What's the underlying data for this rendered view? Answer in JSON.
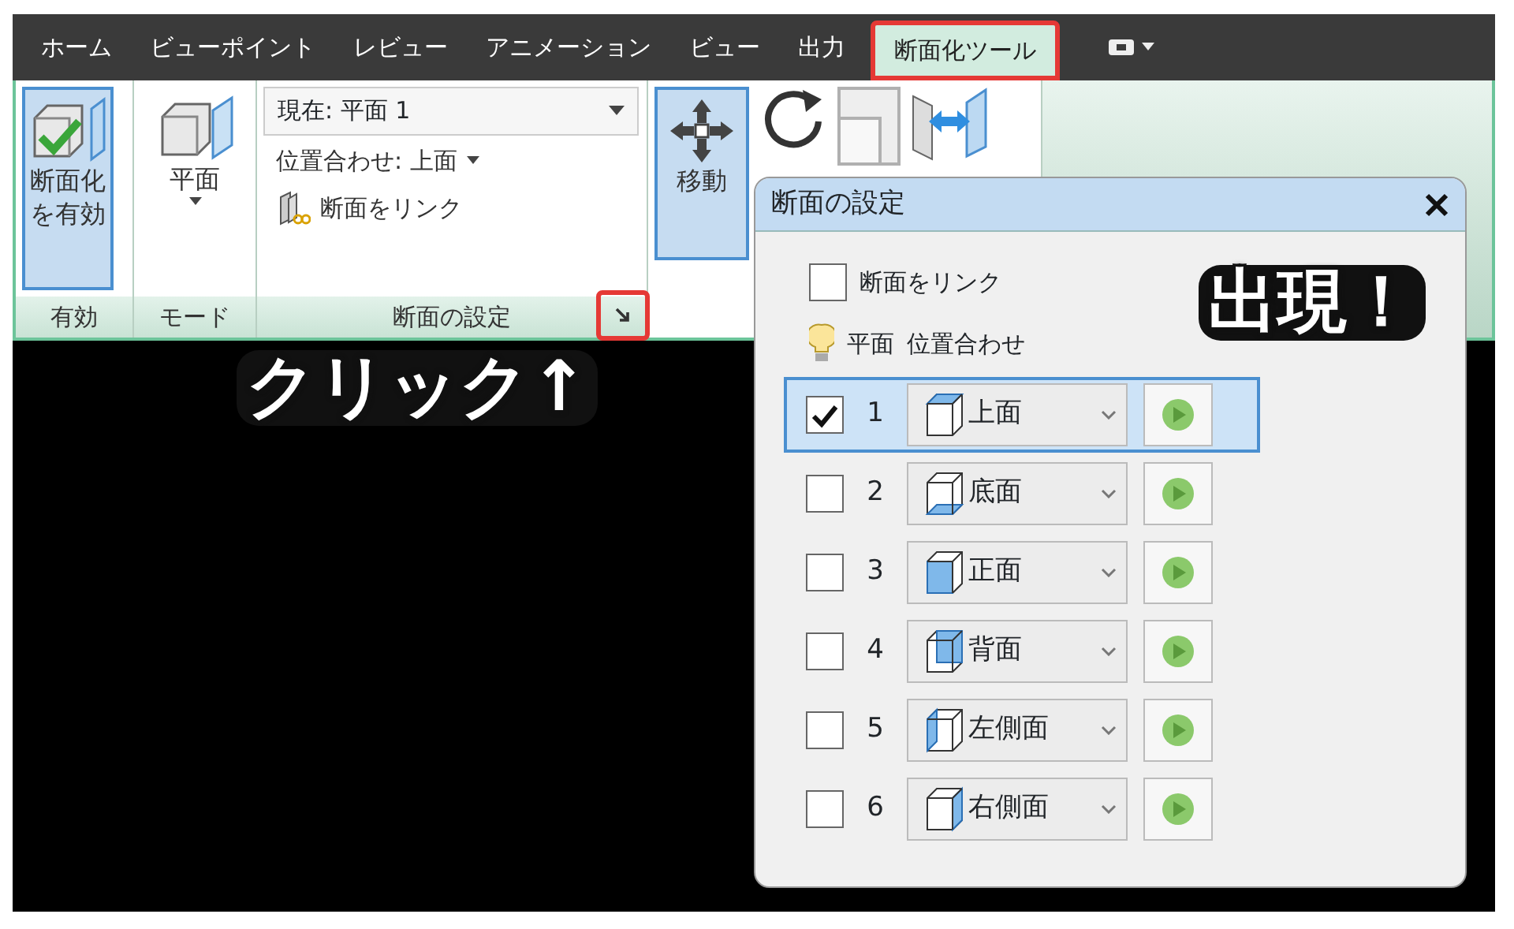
{
  "tabs": [
    {
      "label": "ホーム",
      "selected": false,
      "highlighted": false
    },
    {
      "label": "ビューポイント",
      "selected": false,
      "highlighted": false
    },
    {
      "label": "レビュー",
      "selected": false,
      "highlighted": false
    },
    {
      "label": "アニメーション",
      "selected": false,
      "highlighted": false
    },
    {
      "label": "ビュー",
      "selected": false,
      "highlighted": false
    },
    {
      "label": "出力",
      "selected": false,
      "highlighted": false
    },
    {
      "label": "断面化ツール",
      "selected": true,
      "highlighted": true
    }
  ],
  "ribbon": {
    "enable_panel": {
      "label": "有効",
      "button": {
        "label": "断面化を有効",
        "pressed": true
      }
    },
    "mode_panel": {
      "label": "モード",
      "button": {
        "label": "平面"
      }
    },
    "settings_panel": {
      "label": "断面の設定",
      "current_plane": "現在: 平面 1",
      "alignment": "位置合わせ: 上面",
      "link_button": "断面をリンク",
      "launcher_highlighted": true
    },
    "transform_panel": {
      "move_button": {
        "label": "移動",
        "pressed": true
      }
    }
  },
  "dialog": {
    "title": "断面の設定",
    "link_checkbox": {
      "label": "断面をリンク",
      "checked": false
    },
    "header": {
      "column_1": "平面",
      "column_2": "位置合わせ"
    },
    "rows": [
      {
        "number": "1",
        "checked": true,
        "selected": true,
        "face": "上面",
        "kind": "top"
      },
      {
        "number": "2",
        "checked": false,
        "selected": false,
        "face": "底面",
        "kind": "bottom"
      },
      {
        "number": "3",
        "checked": false,
        "selected": false,
        "face": "正面",
        "kind": "front"
      },
      {
        "number": "4",
        "checked": false,
        "selected": false,
        "face": "背面",
        "kind": "back"
      },
      {
        "number": "5",
        "checked": false,
        "selected": false,
        "face": "左側面",
        "kind": "left"
      },
      {
        "number": "6",
        "checked": false,
        "selected": false,
        "face": "右側面",
        "kind": "right"
      }
    ]
  },
  "annotations": [
    {
      "text": "クリック↑",
      "kind": "click"
    },
    {
      "text": "出現！",
      "kind": "appear"
    }
  ]
}
